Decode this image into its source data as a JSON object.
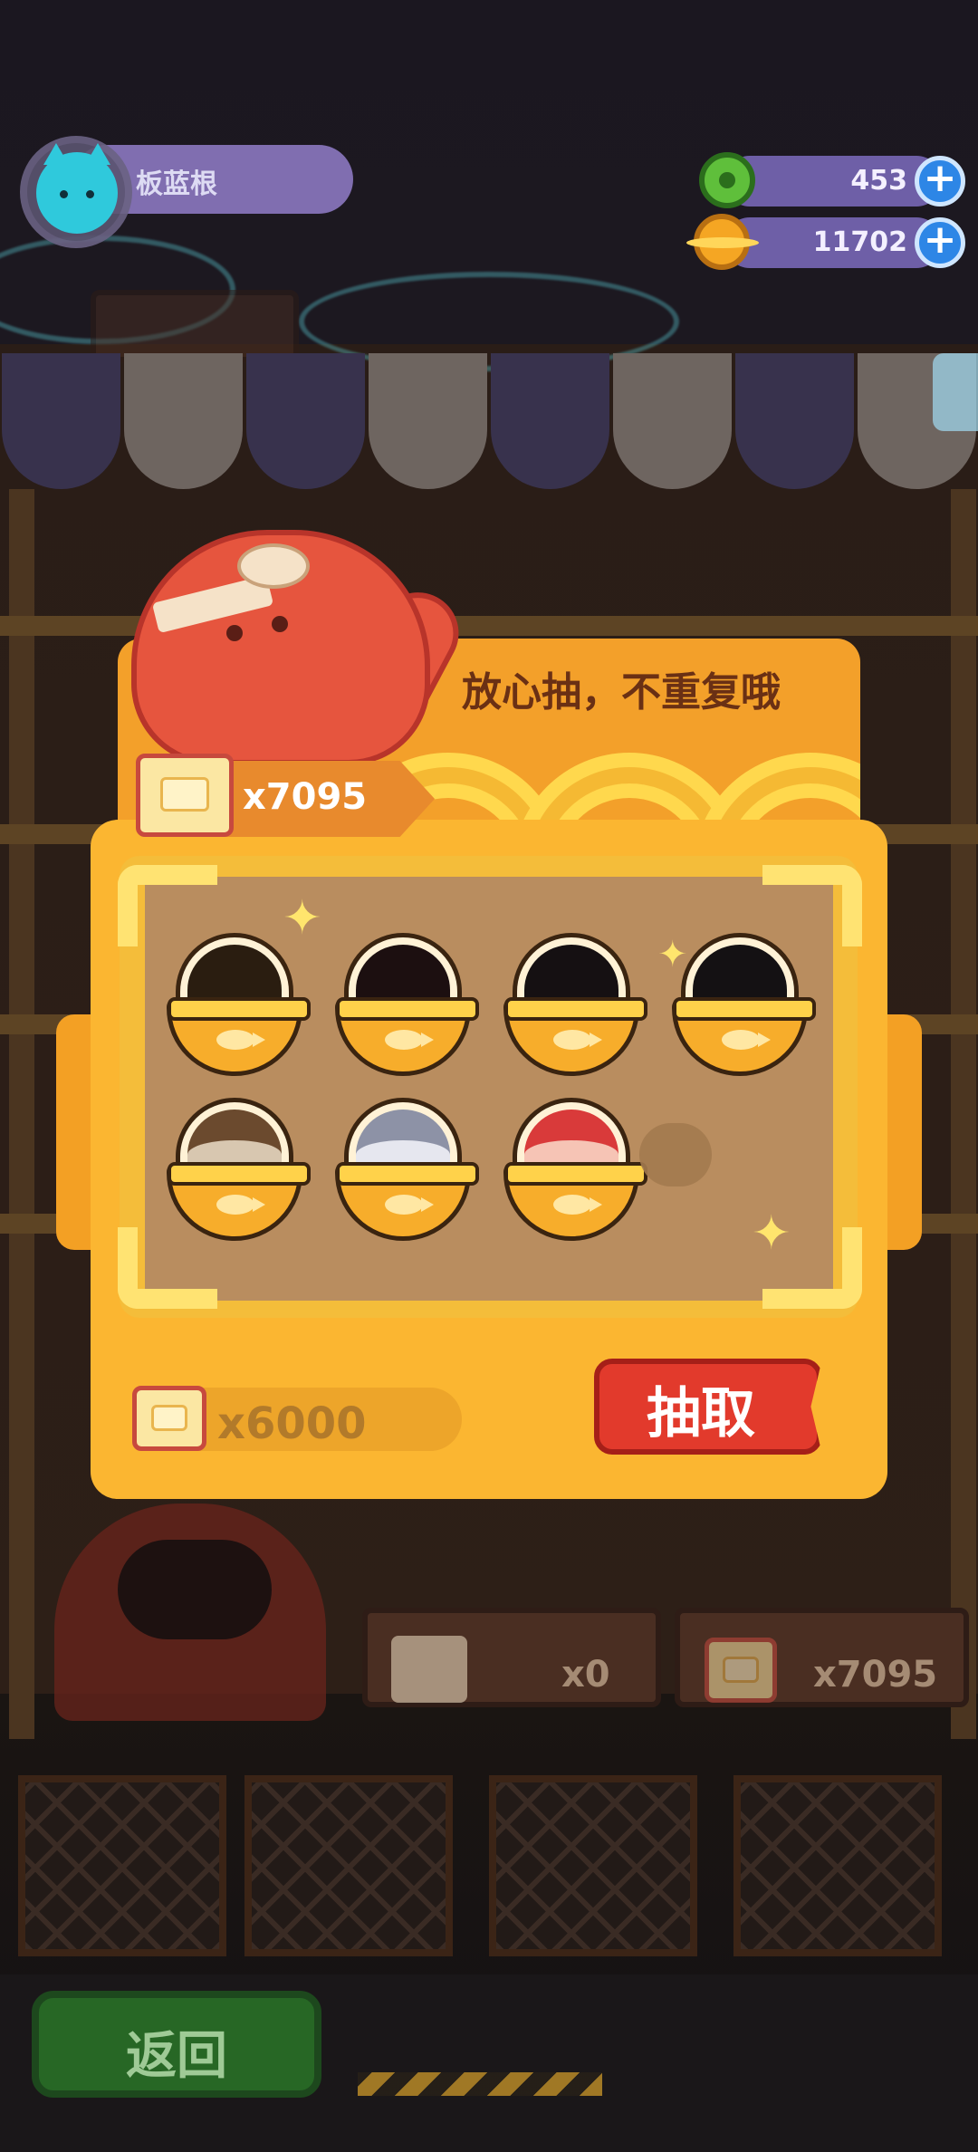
{
  "player": {
    "name": "板蓝根",
    "avatar_icon": "cat-avatar-icon"
  },
  "currencies": [
    {
      "name": "donut",
      "icon": "donut-icon",
      "amount": "453",
      "color": "#5fbf3b"
    },
    {
      "name": "planet",
      "icon": "planet-coin-icon",
      "amount": "11702",
      "color": "#f5a623"
    }
  ],
  "gacha": {
    "banner_text": "放心抽，不重复哦",
    "ticket_balance": "x7095",
    "draw_cost": "x6000",
    "draw_button_label": "抽取",
    "slots": [
      {
        "state": "locked-silhouette",
        "char_color": "#2a1d10"
      },
      {
        "state": "locked-silhouette",
        "char_color": "#1c0f10"
      },
      {
        "state": "locked-silhouette",
        "char_color": "#151012"
      },
      {
        "state": "locked-silhouette",
        "char_color": "#141113"
      },
      {
        "state": "available",
        "char_color": "#d8c7b0"
      },
      {
        "state": "available",
        "char_color": "#b9bcc8"
      },
      {
        "state": "available",
        "char_color": "#f0a7a0"
      }
    ]
  },
  "stands": [
    {
      "icon": "sushi-ticket-icon",
      "count": "x0"
    },
    {
      "icon": "gacha-ticket-icon",
      "count": "x7095"
    }
  ],
  "back_button_label": "返回",
  "colors": {
    "modal_orange": "#fbb631",
    "draw_red": "#e23a2c",
    "hud_purple": "#7c6cc0",
    "plus_blue": "#2d86e6"
  }
}
